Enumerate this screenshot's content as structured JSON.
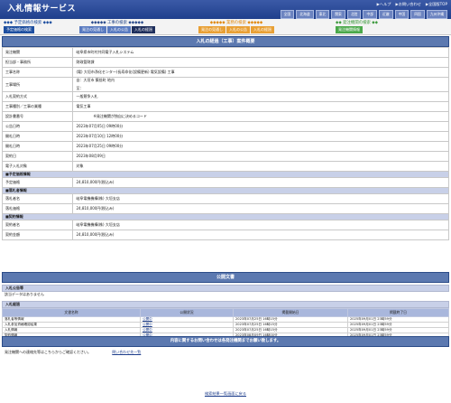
{
  "header": {
    "title": "入札情報サービス",
    "links": [
      "▶ヘルプ",
      "▶お問い合わせ",
      "▶全国版TOP"
    ],
    "regions": [
      "全国",
      "北海道",
      "東北",
      "関東",
      "北陸",
      "中部",
      "近畿",
      "中国",
      "四国",
      "九州沖縄"
    ]
  },
  "nav": {
    "groups": [
      {
        "title": "◆◆◆ 予定価格の検索 ◆◆◆",
        "color": "#1e4fa0",
        "tabs": [
          "予定価格の検索"
        ]
      },
      {
        "title": "◆◆◆◆◆ 工事の検索 ◆◆◆◆◆",
        "color": "#2a4b8c",
        "tabs": [
          "発注の見通し",
          "入札の公告",
          "入札の経過"
        ]
      },
      {
        "title": "◆◆◆◆◆ 業務の検索 ◆◆◆◆◆",
        "color": "#e08a12",
        "tabs": [
          "発注の見通し",
          "入札の公告",
          "入札の経過"
        ]
      },
      {
        "title": "◆◆ 発注機関の検索 ◆◆",
        "color": "#3d9a3d",
        "tabs": [
          "発注機関情報"
        ]
      }
    ]
  },
  "detail": {
    "section_title": "入札の経過（工事）案件概要",
    "rows": [
      {
        "label": "発注機関",
        "value": "岐阜県市町村共同電子入札システム"
      },
      {
        "label": "担当部・事務所",
        "value": "財政管財課"
      },
      {
        "label": "工事名称",
        "value": "(電) 大垣市浄化センター(長寿命化(設備更新) 電気設備) 工事"
      },
      {
        "label": "工事場所",
        "value": "自：大垣市 築捨町 地内",
        "value2": "至："
      },
      {
        "label": "入札契約方式",
        "value": "一般競争入札"
      },
      {
        "label": "工事種別／工事の業種",
        "value": "電気工事"
      },
      {
        "label": "設計書番号",
        "value": "※発注機関が独自に決めるコード"
      },
      {
        "label": "公告日時",
        "value": "2023年07月05日 09時00分"
      },
      {
        "label": "開札日時",
        "value": "2023年07月10日 12時00分"
      },
      {
        "label": "開札日時",
        "value": "2023年07月25日 09時00分"
      },
      {
        "label": "契約日",
        "value": "2023年08月09日"
      },
      {
        "label": "電子入札対象",
        "value": "対象"
      }
    ],
    "price_group": "■予定価格情報",
    "price_rows": [
      {
        "label": "予定価格",
        "value": "24,810,000円(税込み)"
      }
    ],
    "winner_group": "■落札者情報",
    "winner_rows": [
      {
        "label": "落札者名",
        "value": "岐阜電機機構(株) 大垣支店"
      },
      {
        "label": "落札価格",
        "value": "24,810,000円(税込み)"
      }
    ],
    "contract_group": "■契約情報",
    "contract_rows": [
      {
        "label": "契約者名",
        "value": "岐阜電機機構(株) 大垣支店"
      },
      {
        "label": "契約金額",
        "value": "24,810,000円(税込み)"
      }
    ]
  },
  "public_docs": {
    "section_title": "公開文書",
    "announce_head": "入札公告等",
    "announce_text": "該当データはありません",
    "progress_head": "入札経過",
    "columns": [
      "文書名称",
      "公開状況",
      "掲載開始日",
      "掲載終了日"
    ],
    "rows": [
      {
        "name": "落札者等情報",
        "status": "公開中",
        "start": "2023年07月25日 16時15分",
        "end": "2025年09月01日 23時59分"
      },
      {
        "name": "入札参加資格確認結果",
        "status": "公開中",
        "start": "2023年07月25日 16時15分",
        "end": "2025年09月01日 23時59分"
      },
      {
        "name": "入札情報",
        "status": "公開中",
        "start": "2023年07月25日 16時15分",
        "end": "2025年09月01日 23時59分"
      },
      {
        "name": "契約情報",
        "status": "公開中",
        "start": "2023年08月09日 16時00分",
        "end": "2025年09月01日 23時59分"
      }
    ]
  },
  "contact": {
    "bar_text": "内容に関するお問い合わせは各発注機関までお願い致します。",
    "text": "発注機関への連絡先等はこちらからご確認ください。",
    "link": "問い合わせ先一覧"
  },
  "back_link": "検索結果一覧画面に戻る"
}
